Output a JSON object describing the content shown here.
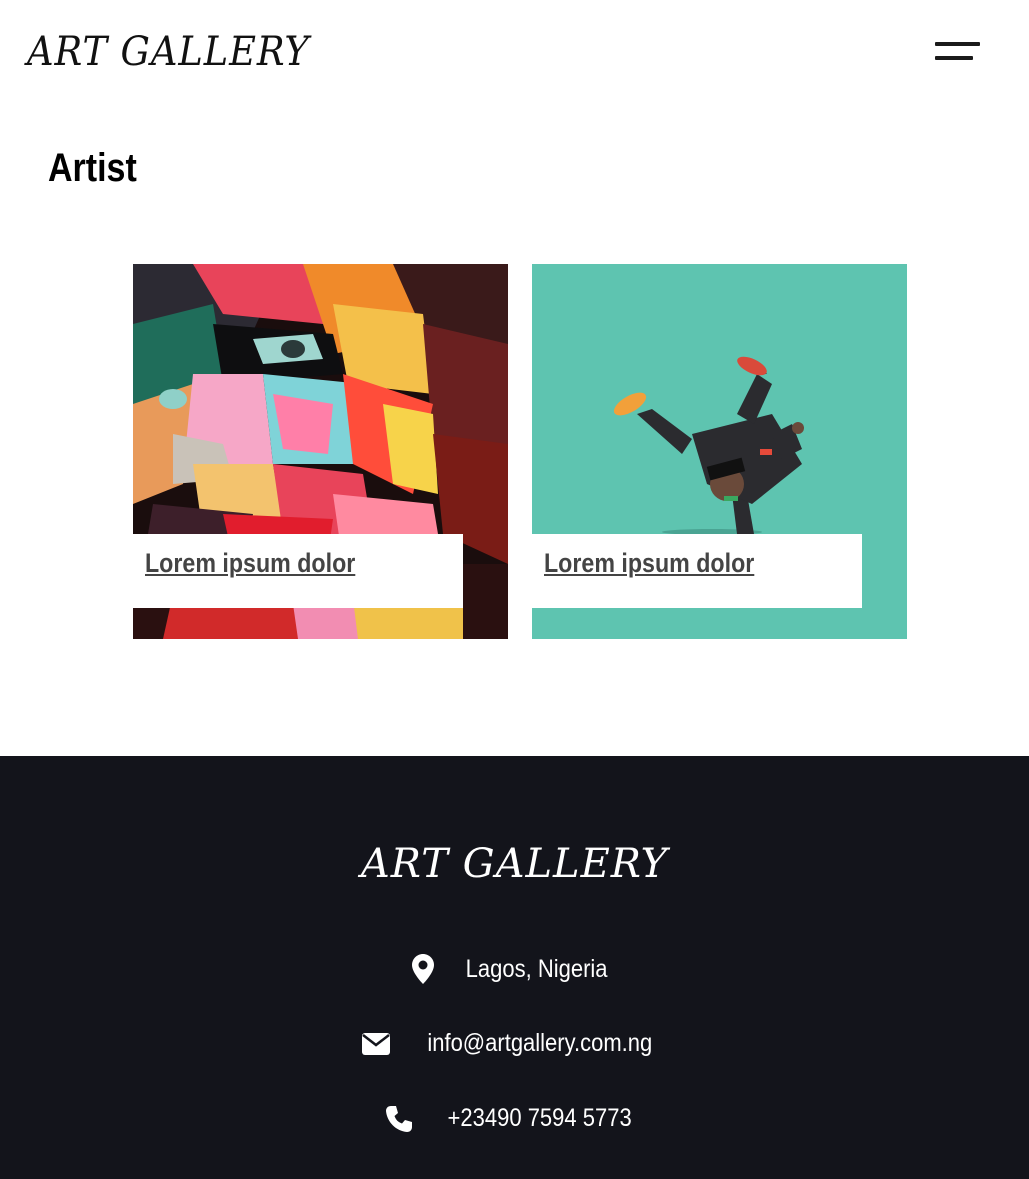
{
  "header": {
    "logo": "ART GALLERY",
    "menu_icon": "hamburger-menu-icon"
  },
  "page": {
    "title": "Artist"
  },
  "cards": [
    {
      "caption": "Lorem ipsum dolor",
      "image": "colorful-face-painting"
    },
    {
      "caption": "Lorem ipsum dolor",
      "image": "breakdancer-on-teal"
    }
  ],
  "footer": {
    "logo": "ART GALLERY",
    "location": "Lagos, Nigeria",
    "email": "info@artgallery.com.ng",
    "phone": "+23490 7594 5773",
    "background": "#13141b",
    "icons": [
      "map-pin-icon",
      "envelope-icon",
      "phone-icon"
    ]
  },
  "colors": {
    "teal": "#5ec4b0",
    "text_dark": "#111111",
    "caption_link": "#444444"
  }
}
